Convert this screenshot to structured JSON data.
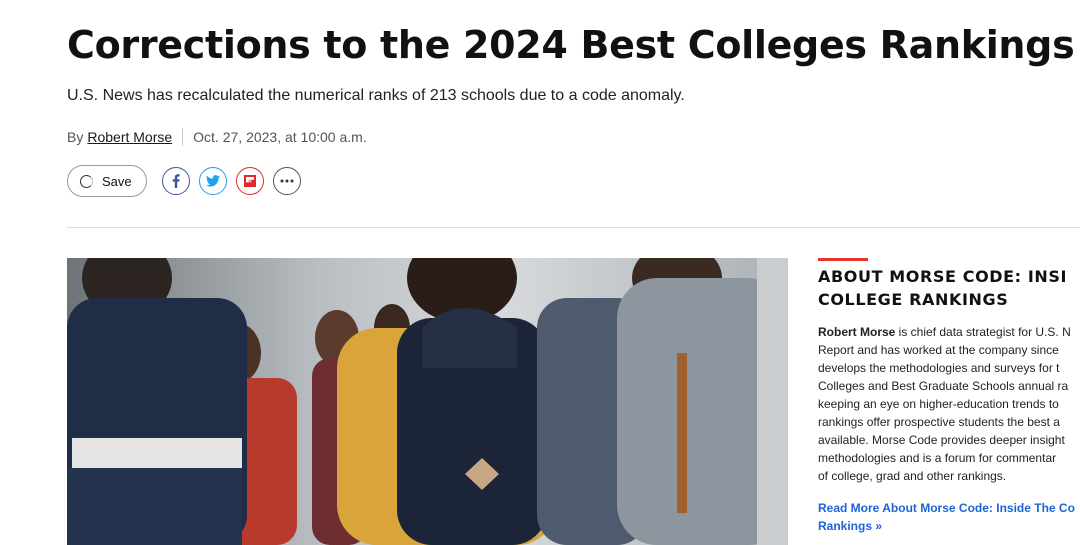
{
  "article": {
    "headline": "Corrections to the 2024 Best Colleges Rankings",
    "subhead": "U.S. News has recalculated the numerical ranks of 213 schools due to a code anomaly.",
    "byline_prefix": "By",
    "author": "Robert Morse",
    "date": "Oct. 27, 2023, at 10:00 a.m."
  },
  "actions": {
    "save_label": "Save",
    "share_icons": [
      "facebook-icon",
      "twitter-icon",
      "flipboard-icon",
      "more-icon"
    ]
  },
  "hero_image": {
    "alt": "Students with backpacks walking"
  },
  "sidebar": {
    "title_line1": "ABOUT MORSE CODE: INSI",
    "title_line2": "COLLEGE RANKINGS",
    "bio_name": "Robert Morse",
    "bio_lines": [
      " is chief data strategist for U.S. N",
      "Report and has worked at the company since",
      "develops the methodologies and surveys for t",
      "Colleges and Best Graduate Schools annual ra",
      "keeping an eye on higher-education trends to",
      "rankings offer prospective students the best a",
      "available. Morse Code provides deeper insight",
      "methodologies and is a forum for commentar",
      "of college, grad and other rankings."
    ],
    "read_more_line1": "Read More About Morse Code: Inside The Co",
    "read_more_line2": "Rankings »"
  },
  "colors": {
    "accent_red": "#e8352b",
    "link_blue": "#1c64d8",
    "facebook": "#3b5998",
    "twitter": "#1da1f2",
    "flipboard": "#e12828"
  }
}
